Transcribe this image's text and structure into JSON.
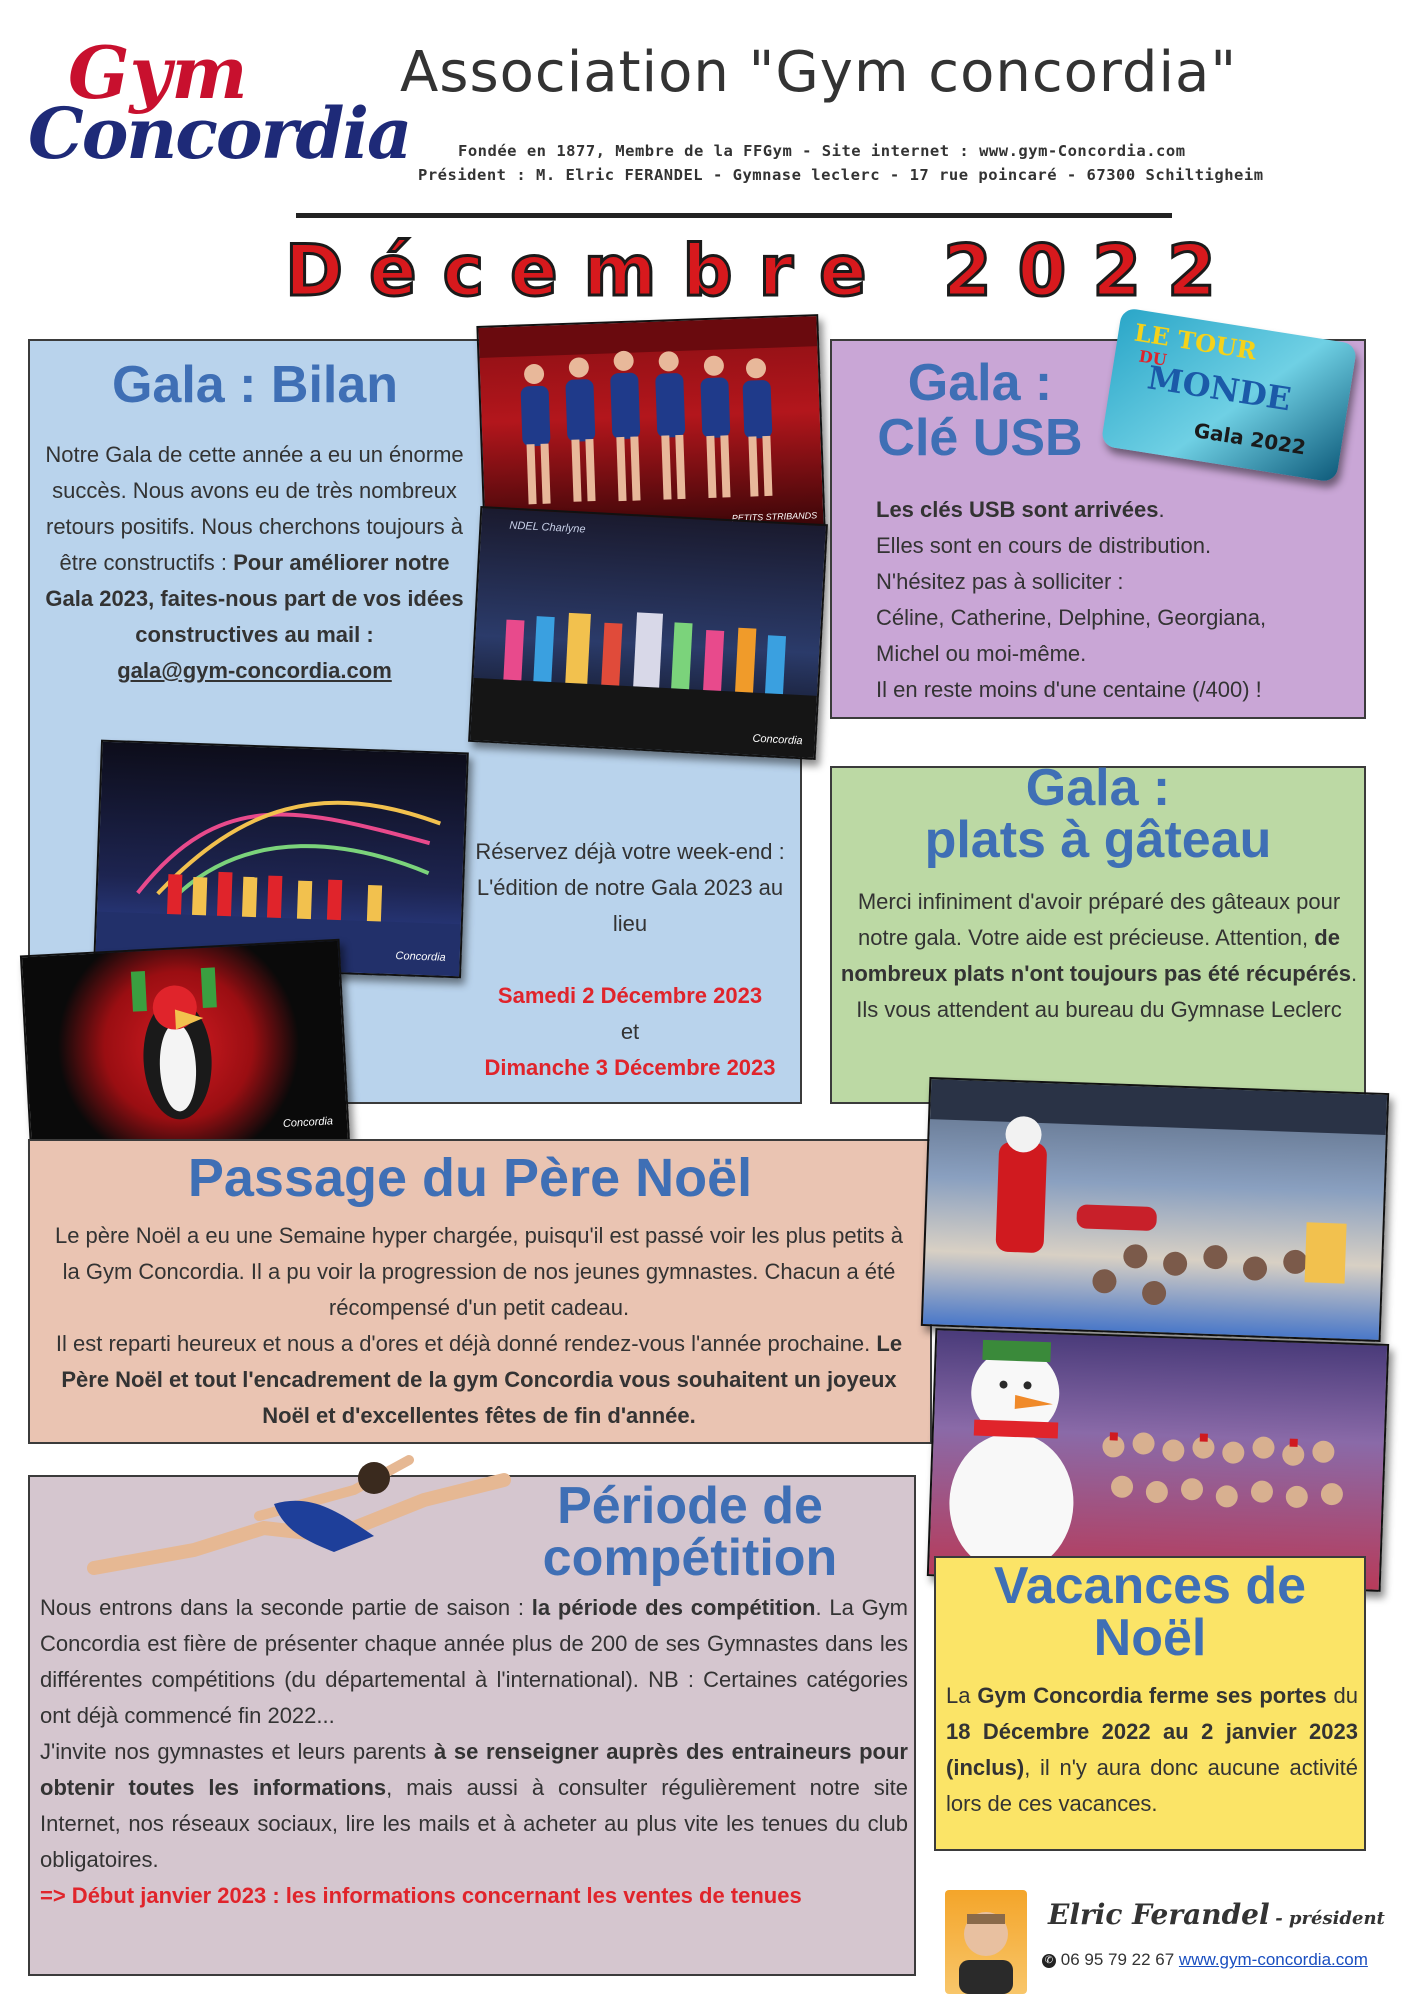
{
  "header": {
    "logo_top": "Gym",
    "logo_bottom": "Concordia",
    "title": "Association \"Gym concordia\"",
    "info_line1": "Fondée en 1877, Membre de la FFGym - Site internet : www.gym-Concordia.com",
    "info_line2": "Président : M. Elric FERANDEL - Gymnase leclerc - 17 rue poincaré - 67300 Schiltigheim",
    "month": "Décembre 2022"
  },
  "gala_bilan": {
    "title": "Gala : Bilan",
    "p1": "Notre Gala de cette année a eu un énorme succès. Nous avons eu de très nombreux retours positifs. Nous cherchons toujours à être constructifs : ",
    "p1_bold": "Pour améliorer notre Gala 2023, faites-nous part de vos idées constructives au mail :",
    "email": "gala@gym-concordia.com",
    "reserve": "Réservez déjà votre week-end : L'édition de notre Gala 2023 au lieu",
    "date1": "Samedi 2 Décembre 2023",
    "et": "et",
    "date2": "Dimanche 3 Décembre 2023",
    "photo1_caption": "PETITS STRIBANDS",
    "photo2_caption": "NDEL Charlyne",
    "logo_mark": "Concordia"
  },
  "gala_usb": {
    "title": "Gala :\nClé USB",
    "usb_line1": "LE TOUR",
    "usb_line2": "DU",
    "usb_line3": "MONDE",
    "usb_line4": "Gala 2022",
    "bold_line": "Les clés USB sont arrivées",
    "lines": [
      "Elles sont en cours de distribution.",
      "N'hésitez pas à solliciter :",
      "Céline, Catherine, Delphine, Georgiana,",
      "Michel ou moi-même.",
      "Il en reste moins d'une centaine (/400) !"
    ]
  },
  "gala_plats": {
    "title": "Gala :\nplats à gâteau",
    "t1": "Merci infiniment d'avoir préparé des gâteaux pour notre gala. Votre aide est précieuse. Attention, ",
    "t_bold": "de nombreux plats n'ont toujours pas été récupérés",
    "t2": ". Ils vous attendent au bureau du Gymnase Leclerc"
  },
  "pere_noel": {
    "title": "Passage du Père Noël",
    "t1": "Le père Noël a eu une Semaine hyper chargée, puisqu'il est passé voir les plus petits à la Gym Concordia. Il a pu voir la progression de nos jeunes gymnastes. Chacun a été récompensé d'un petit cadeau.",
    "t2": "Il est reparti heureux et nous a d'ores et déjà donné rendez-vous l'année prochaine. ",
    "t2_bold": "Le Père Noël et tout l'encadrement de la gym Concordia vous souhaitent un joyeux Noël et d'excellentes fêtes de fin d'année."
  },
  "competition": {
    "title": "Période de\ncompétition",
    "p1a": "Nous entrons dans la seconde partie de saison : ",
    "p1b": "la période des compétition",
    "p1c": ". La Gym Concordia est fière de présenter chaque année plus de 200 de ses Gymnastes dans les différentes compétitions (du départemental à l'international). NB : Certaines catégories ont déjà commencé fin 2022...",
    "p2a": "J'invite nos gymnastes et leurs parents ",
    "p2b": "à se renseigner auprès des entraineurs pour obtenir toutes les informations",
    "p2c": ", mais aussi à consulter régulièrement notre site Internet, nos réseaux sociaux, lire les mails et à acheter au plus vite les tenues du club obligatoires.",
    "p3": "=> Début janvier 2023 : les informations concernant les ventes de tenues"
  },
  "vacances": {
    "title": "Vacances de\nNoël",
    "t1": "La ",
    "t1b": "Gym Concordia ferme ses portes",
    "t2": " du ",
    "t2b": "18 Décembre 2022 au 2 janvier 2023 (inclus)",
    "t3": ", il n'y aura donc aucune activité lors de ces vacances."
  },
  "signature": {
    "name": "Elric Ferandel",
    "role": "- président",
    "phone": "06 95 79 22 67",
    "site": "www.gym-concordia.com"
  },
  "colors": {
    "blue_box": "#b9d3ec",
    "purple_box": "#c9a6d6",
    "green_box": "#bcd9a4",
    "salmon_box": "#eac4b2",
    "mauve_box": "#d5c6cf",
    "yellow_box": "#fbe467",
    "title_blue": "#3f6fb5",
    "red": "#e0242b"
  }
}
